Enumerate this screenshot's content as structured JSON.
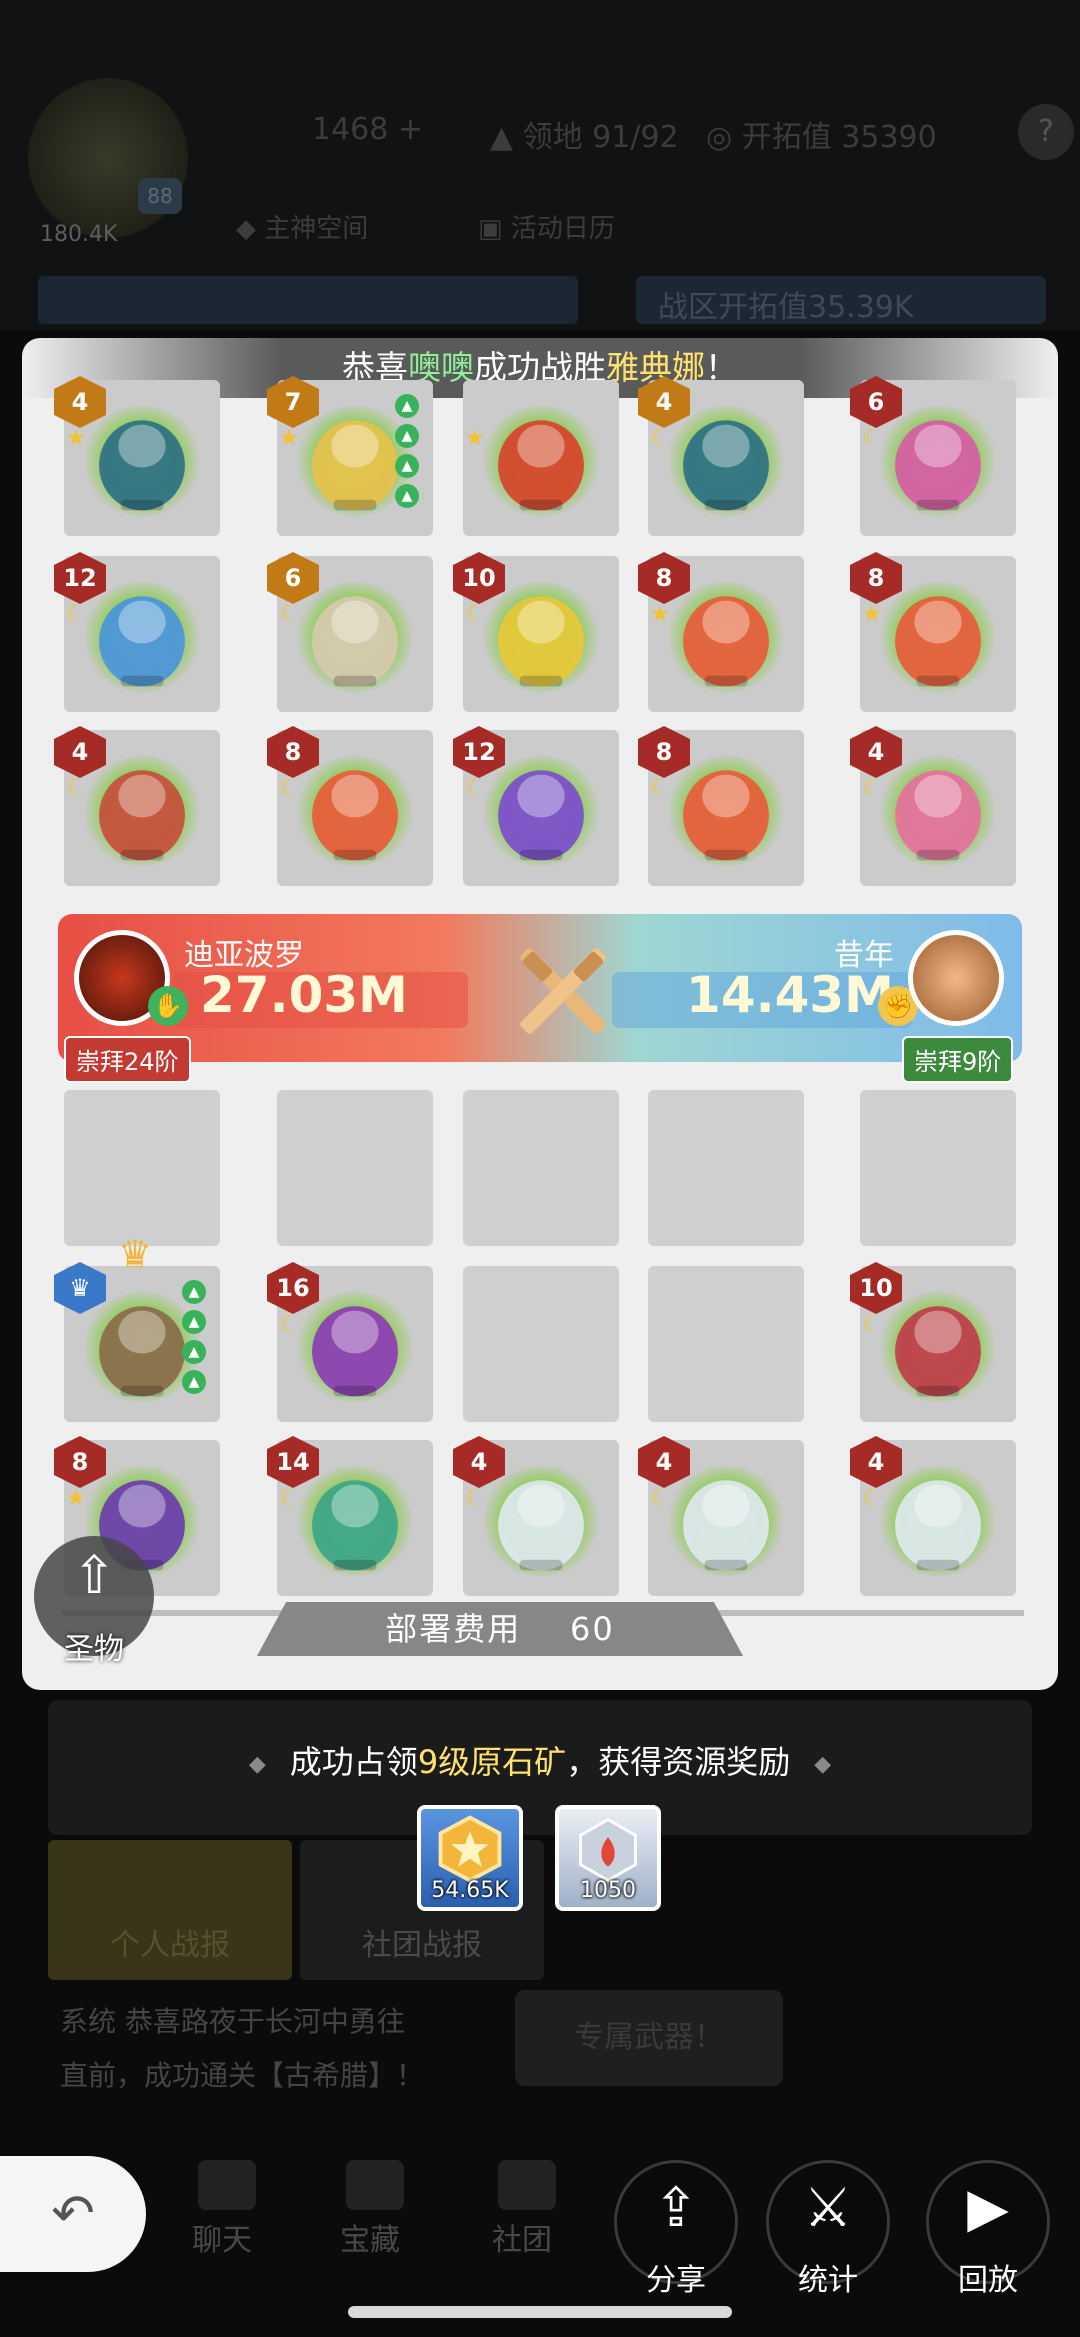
{
  "background": {
    "stats": {
      "gems": "1468",
      "territory_label": "领地",
      "territory": "91/92",
      "explore_label": "开拓值",
      "explore": "35390"
    },
    "level": "88",
    "power": "180.4K",
    "links": {
      "space": "主神空间",
      "calendar": "活动日历"
    },
    "banner_right": "战区开拓值35.39K",
    "tabs": {
      "personal": "个人战报",
      "guild": "社团战报"
    },
    "log_line1": "系统   恭喜路夜于长河中勇往",
    "log_line2": "直前，成功通关【古希腊】！",
    "dark_button": "专属武器！",
    "nav": {
      "chat": "聊天",
      "treasure": "宝藏",
      "guild": "社团"
    }
  },
  "modal": {
    "title_prefix": "恭喜",
    "title_player": "噢噢",
    "title_mid": "成功战胜",
    "title_enemy": "雅典娜",
    "title_suffix": "！",
    "enemy_units": [
      {
        "level": "4",
        "name": "bronze-cauldron",
        "mark": "star",
        "badge": "orange"
      },
      {
        "level": "7",
        "name": "calabash-boy-yellow",
        "mark": "star",
        "badge": "orange",
        "upgrades": 4
      },
      {
        "level": "",
        "name": "fire-demon",
        "mark": "star",
        "badge": "none"
      },
      {
        "level": "4",
        "name": "bronze-cauldron",
        "mark": "moon",
        "badge": "orange"
      },
      {
        "level": "6",
        "name": "calabash-boy-pink",
        "mark": "moon",
        "badge": "red"
      },
      {
        "level": "12",
        "name": "blue-crystal",
        "mark": "moon",
        "badge": "red"
      },
      {
        "level": "6",
        "name": "thatched-cottage",
        "mark": "moon",
        "badge": "orange"
      },
      {
        "level": "10",
        "name": "golden-ruyi",
        "mark": "moon",
        "badge": "red"
      },
      {
        "level": "8",
        "name": "owl-bell",
        "mark": "star",
        "badge": "red"
      },
      {
        "level": "8",
        "name": "owl-bell",
        "mark": "star",
        "badge": "red"
      },
      {
        "level": "4",
        "name": "calabash-vine",
        "mark": "moon",
        "badge": "red"
      },
      {
        "level": "8",
        "name": "owl-bell",
        "mark": "moon",
        "badge": "red"
      },
      {
        "level": "12",
        "name": "calabash-boy-purple",
        "mark": "moon",
        "badge": "red"
      },
      {
        "level": "8",
        "name": "owl-bell",
        "mark": "moon",
        "badge": "red"
      },
      {
        "level": "4",
        "name": "lotus-platform",
        "mark": "moon",
        "badge": "red"
      }
    ],
    "battle": {
      "left_name": "迪亚波罗",
      "left_power": "27.03M",
      "left_rank": "崇拜24阶",
      "right_name": "昔年",
      "right_power": "14.43M",
      "right_rank": "崇拜9阶"
    },
    "player_units": [
      {
        "level": "",
        "name": "empty"
      },
      {
        "level": "",
        "name": "empty"
      },
      {
        "level": "",
        "name": "empty"
      },
      {
        "level": "",
        "name": "empty"
      },
      {
        "level": "",
        "name": "empty"
      },
      {
        "level": "",
        "name": "crowned-gunner",
        "mark": "none",
        "badge": "blue",
        "upgrades": 4
      },
      {
        "level": "16",
        "name": "purple-witch",
        "mark": "moon",
        "badge": "red"
      },
      {
        "level": "",
        "name": "empty"
      },
      {
        "level": "",
        "name": "empty"
      },
      {
        "level": "10",
        "name": "dice-girl",
        "mark": "moon",
        "badge": "red"
      },
      {
        "level": "8",
        "name": "purple-hood-girl",
        "mark": "star",
        "badge": "red"
      },
      {
        "level": "14",
        "name": "green-witch",
        "mark": "moon",
        "badge": "red"
      },
      {
        "level": "4",
        "name": "white-whale",
        "mark": "moon",
        "badge": "red"
      },
      {
        "level": "4",
        "name": "white-whale",
        "mark": "moon",
        "badge": "red"
      },
      {
        "level": "4",
        "name": "white-whale",
        "mark": "moon",
        "badge": "red"
      }
    ],
    "deploy_label": "部署费用",
    "deploy_cost": "60",
    "relic_label": "圣物"
  },
  "reward": {
    "text_prefix": "成功占领",
    "text_highlight": "9级原石矿",
    "text_suffix": "，获得资源奖励",
    "items": [
      {
        "name": "gold-medal",
        "qty": "54.65K"
      },
      {
        "name": "ore-crystal",
        "qty": "1050"
      }
    ]
  },
  "controls": {
    "share": "分享",
    "stats": "统计",
    "replay": "回放"
  },
  "colors": {
    "badge_red": "#a62a25",
    "badge_orange": "#c27a16",
    "upgrade_green": "#39b35b",
    "highlight_green": "#8ef29a",
    "highlight_yellow": "#ffe26e"
  }
}
